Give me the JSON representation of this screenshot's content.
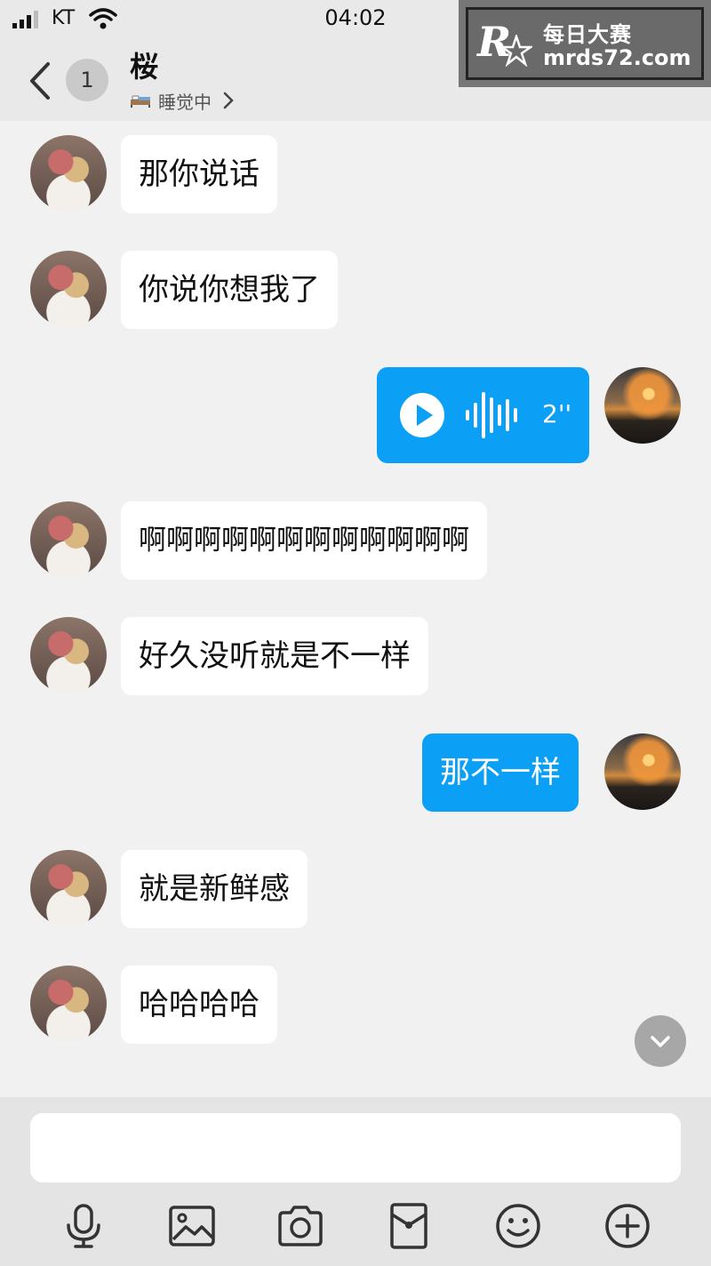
{
  "status_bar": {
    "carrier": "KT",
    "time": "04:02",
    "signal_icon": "signal-bars-icon",
    "wifi_icon": "wifi-icon"
  },
  "header": {
    "back_icon": "chevron-left-icon",
    "unread_count": "1",
    "contact_name": "桜",
    "status_icon": "bed-icon",
    "status_text": "睡觉中",
    "status_chevron_icon": "chevron-right-icon"
  },
  "watermark": {
    "logo_letter": "R",
    "title": "每日大赛",
    "url": "mrds72.com"
  },
  "messages": [
    {
      "sender": "them",
      "type": "text",
      "text": "那你说话"
    },
    {
      "sender": "them",
      "type": "text",
      "text": "你说你想我了"
    },
    {
      "sender": "me",
      "type": "voice",
      "duration": "2''"
    },
    {
      "sender": "them",
      "type": "text",
      "text": "啊啊啊啊啊啊啊啊啊啊啊啊"
    },
    {
      "sender": "them",
      "type": "text",
      "text": "好久没听就是不一样"
    },
    {
      "sender": "me",
      "type": "text",
      "text": "那不一样"
    },
    {
      "sender": "them",
      "type": "text",
      "text": "就是新鲜感"
    },
    {
      "sender": "them",
      "type": "text",
      "text": "哈哈哈哈"
    }
  ],
  "input": {
    "value": "",
    "placeholder": ""
  },
  "toolbar": {
    "icons": [
      "microphone-icon",
      "image-icon",
      "camera-icon",
      "red-packet-icon",
      "emoji-icon",
      "plus-icon"
    ]
  },
  "colors": {
    "accent": "#0ba0f5",
    "background": "#f1f1f1",
    "header_bg": "#e9e9e9"
  }
}
